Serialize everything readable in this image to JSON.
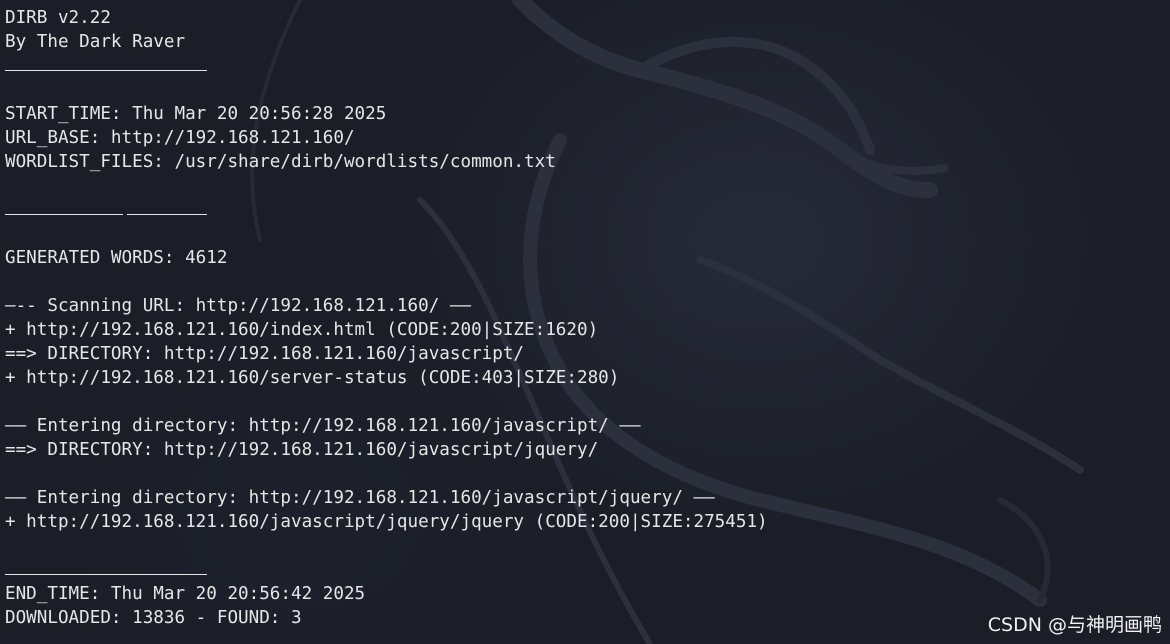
{
  "terminal": {
    "lines": [
      "DIRB v2.22",
      "By The Dark Raver",
      "",
      "",
      "START_TIME: Thu Mar 20 20:56:28 2025",
      "URL_BASE: http://192.168.121.160/",
      "WORDLIST_FILES: /usr/share/dirb/wordlists/common.txt",
      "",
      "",
      "",
      "GENERATED WORDS: 4612",
      "",
      "—-- Scanning URL: http://192.168.121.160/ ——",
      "+ http://192.168.121.160/index.html (CODE:200|SIZE:1620)",
      "==> DIRECTORY: http://192.168.121.160/javascript/",
      "+ http://192.168.121.160/server-status (CODE:403|SIZE:280)",
      "",
      "—— Entering directory: http://192.168.121.160/javascript/ ——",
      "==> DIRECTORY: http://192.168.121.160/javascript/jquery/",
      "",
      "—— Entering directory: http://192.168.121.160/javascript/jquery/ ——",
      "+ http://192.168.121.160/javascript/jquery/jquery (CODE:200|SIZE:275451)",
      "",
      "",
      "END_TIME: Thu Mar 20 20:56:42 2025",
      "DOWNLOADED: 13836 - FOUND: 3"
    ]
  },
  "watermark": "CSDN @与神明画鸭",
  "colors": {
    "background": "#1b1e27",
    "text": "#e6e6e6"
  }
}
